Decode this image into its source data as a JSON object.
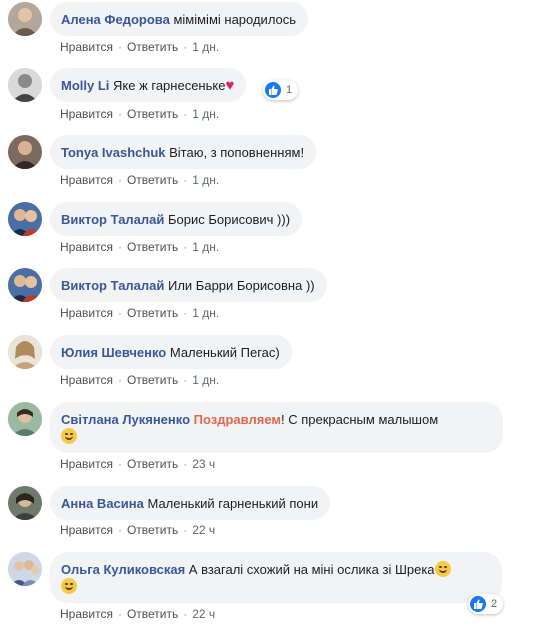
{
  "comments": [
    {
      "author": "Алена Федорова",
      "text": " мімімімі народилось",
      "like": "Нравится",
      "reply": "Ответить",
      "time": "1 дн."
    },
    {
      "author": "Molly Li",
      "text": " Яке ж гарнесеньке",
      "like": "Нравится",
      "reply": "Ответить",
      "time": "1 дн.",
      "reaction_count": "1"
    },
    {
      "author": "Tonya Ivashchuk",
      "text": " Вітаю, з поповненням!",
      "like": "Нравится",
      "reply": "Ответить",
      "time": "1 дн."
    },
    {
      "author": "Виктор Талалай",
      "text": " Борис Борисович )))",
      "like": "Нравится",
      "reply": "Ответить",
      "time": "1 дн."
    },
    {
      "author": "Виктор Талалай",
      "text": " Или Барри Борисовна ))",
      "like": "Нравится",
      "reply": "Ответить",
      "time": "1 дн."
    },
    {
      "author": "Юлия Шевченко",
      "text": " Маленький Пегас)",
      "like": "Нравится",
      "reply": "Ответить",
      "time": "1 дн."
    },
    {
      "author": "Світлана Лукяненко",
      "highlight": "Поздравляем",
      "text": "! С прекрасным малышом",
      "like": "Нравится",
      "reply": "Ответить",
      "time": "23 ч"
    },
    {
      "author": "Анна Васина",
      "text": " Маленький гарненький пони",
      "like": "Нравится",
      "reply": "Ответить",
      "time": "22 ч"
    },
    {
      "author": "Ольга Куликовская",
      "text": " А взагалі схожий на міні ослика зі Шрека",
      "like": "Нравится",
      "reply": "Ответить",
      "time": "22 ч",
      "reaction_count": "2"
    }
  ],
  "colors": {
    "author": "#385898",
    "highlight": "#e0684b",
    "bubble": "#f2f3f5",
    "meta": "#606770",
    "like": "#1877f2"
  }
}
